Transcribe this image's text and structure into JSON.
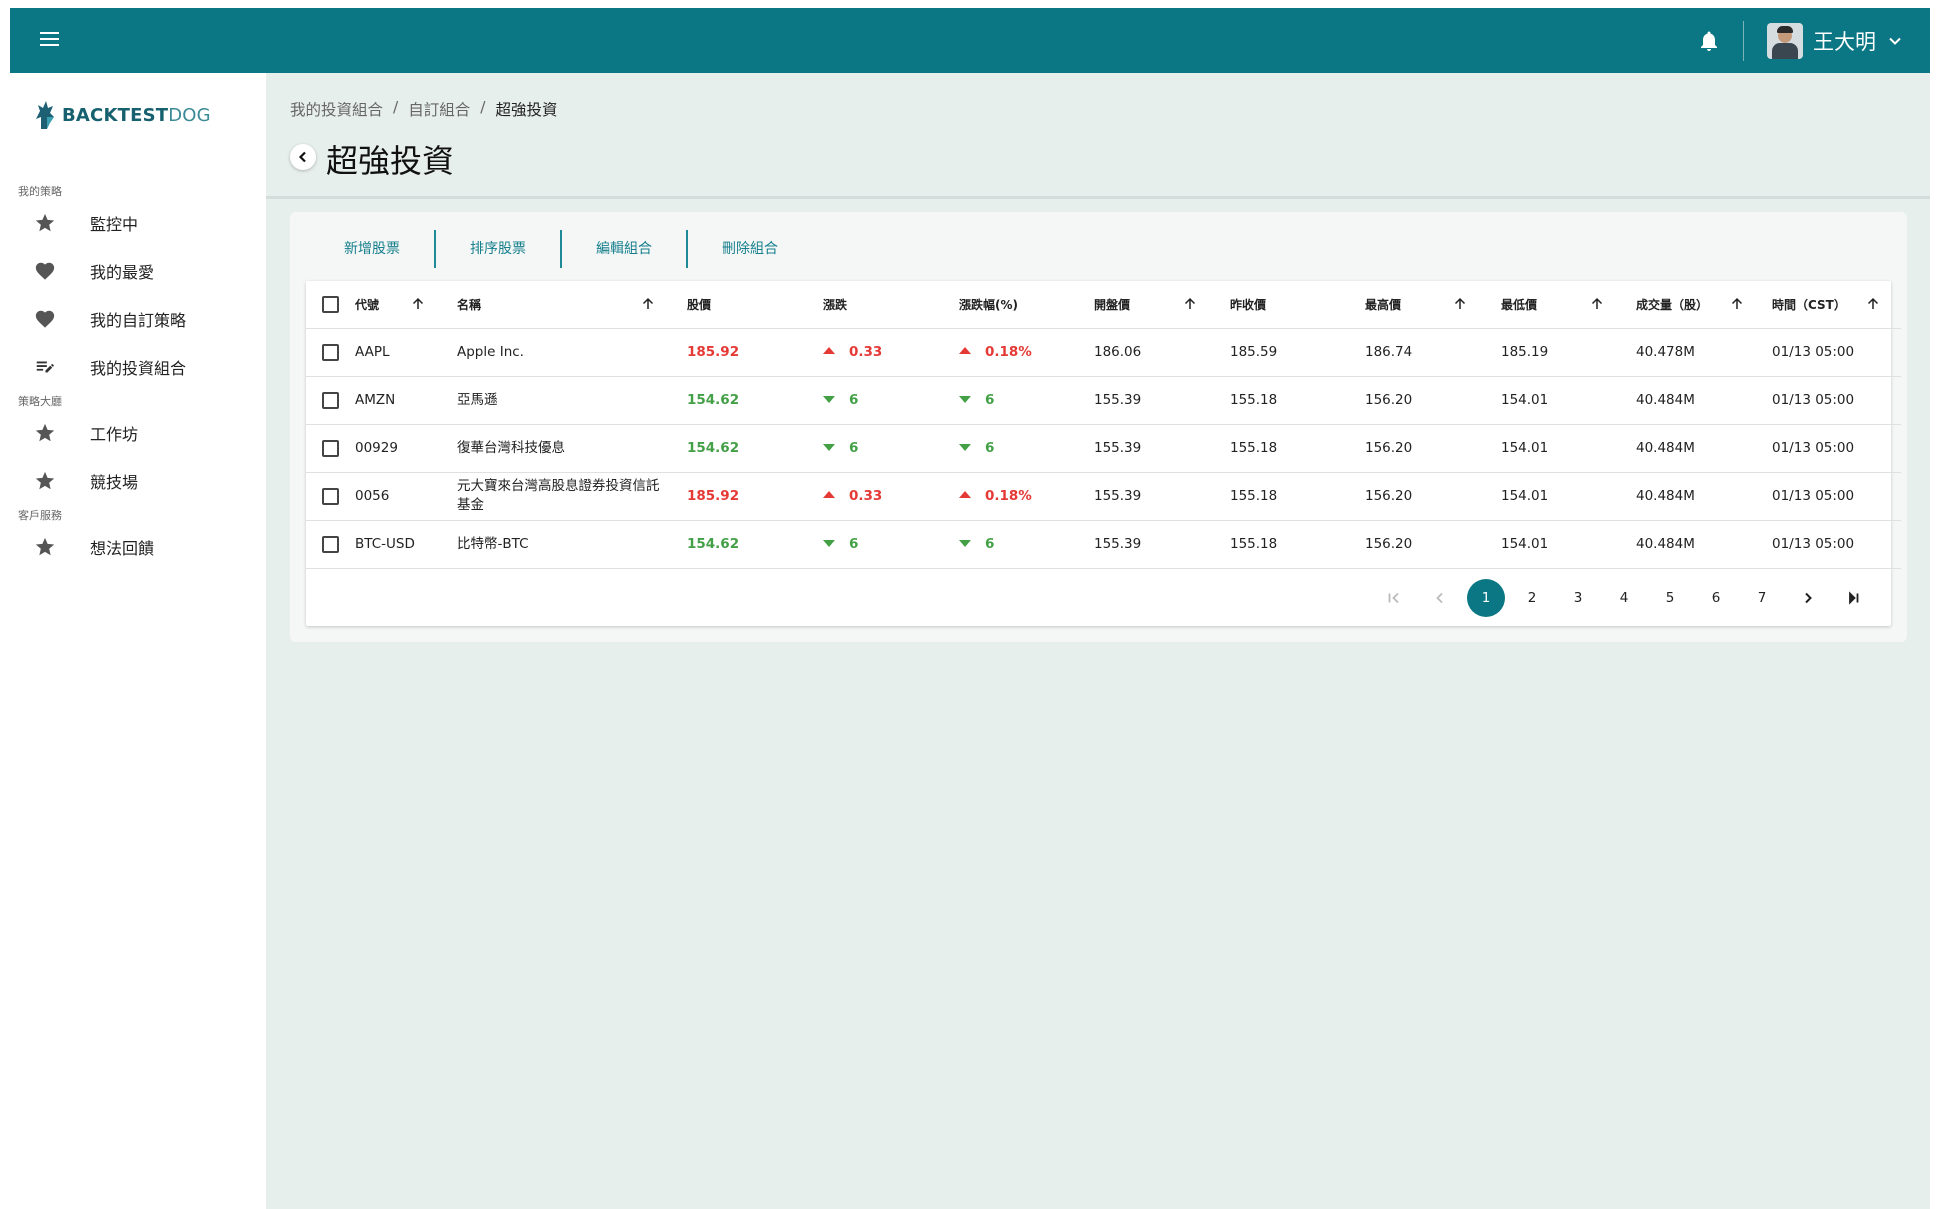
{
  "topbar": {
    "user_name": "王大明",
    "icons": [
      "menu-icon",
      "bell-icon",
      "chevron-down-icon"
    ]
  },
  "sidebar": {
    "logo_part1": "BACKTEST",
    "logo_part2": "DOG",
    "sections": [
      {
        "label": "我的策略",
        "items": [
          {
            "label": "監控中",
            "icon": "star-icon"
          },
          {
            "label": "我的最愛",
            "icon": "heart-icon"
          },
          {
            "label": "我的自訂策略",
            "icon": "heart-icon"
          },
          {
            "label": "我的投資組合",
            "icon": "playlist-edit-icon"
          }
        ]
      },
      {
        "label": "策略大廳",
        "items": [
          {
            "label": "工作坊",
            "icon": "star-icon"
          },
          {
            "label": "競技場",
            "icon": "star-icon"
          }
        ]
      },
      {
        "label": "客戶服務",
        "items": [
          {
            "label": "想法回饋",
            "icon": "star-icon"
          }
        ]
      }
    ]
  },
  "breadcrumb": [
    "我的投資組合",
    "自訂組合",
    "超強投資"
  ],
  "page_title": "超強投資",
  "actions": [
    "新增股票",
    "排序股票",
    "編輯組合",
    "刪除組合"
  ],
  "table": {
    "columns": [
      "代號",
      "名稱",
      "股價",
      "漲跌",
      "漲跌幅(%)",
      "開盤價",
      "昨收價",
      "最高價",
      "最低價",
      "成交量（股）",
      "時間（CST）"
    ],
    "rows": [
      {
        "code": "AAPL",
        "name": "Apple Inc.",
        "price": "185.92",
        "change": "0.33",
        "change_pct": "0.18%",
        "direction": "up",
        "open": "186.06",
        "prev_close": "185.59",
        "high": "186.74",
        "low": "185.19",
        "volume": "40.478M",
        "time": "01/13 05:00"
      },
      {
        "code": "AMZN",
        "name": "亞馬遜",
        "price": "154.62",
        "change": "6",
        "change_pct": "6",
        "direction": "down",
        "open": "155.39",
        "prev_close": "155.18",
        "high": "156.20",
        "low": "154.01",
        "volume": "40.484M",
        "time": "01/13 05:00"
      },
      {
        "code": "00929",
        "name": "復華台灣科技優息",
        "price": "154.62",
        "change": "6",
        "change_pct": "6",
        "direction": "down",
        "open": "155.39",
        "prev_close": "155.18",
        "high": "156.20",
        "low": "154.01",
        "volume": "40.484M",
        "time": "01/13 05:00"
      },
      {
        "code": "0056",
        "name": "元大寶來台灣高股息證券投資信託基金",
        "price": "185.92",
        "change": "0.33",
        "change_pct": "0.18%",
        "direction": "up",
        "open": "155.39",
        "prev_close": "155.18",
        "high": "156.20",
        "low": "154.01",
        "volume": "40.484M",
        "time": "01/13 05:00"
      },
      {
        "code": "BTC-USD",
        "name": "比特幣-BTC",
        "price": "154.62",
        "change": "6",
        "change_pct": "6",
        "direction": "down",
        "open": "155.39",
        "prev_close": "155.18",
        "high": "156.20",
        "low": "154.01",
        "volume": "40.484M",
        "time": "01/13 05:00"
      }
    ]
  },
  "pagination": {
    "pages": [
      "1",
      "2",
      "3",
      "4",
      "5",
      "6",
      "7"
    ],
    "current": "1"
  },
  "colors": {
    "primary": "#0b7784",
    "up": "#e53935",
    "down": "#43a047",
    "background": "#e7efec"
  }
}
